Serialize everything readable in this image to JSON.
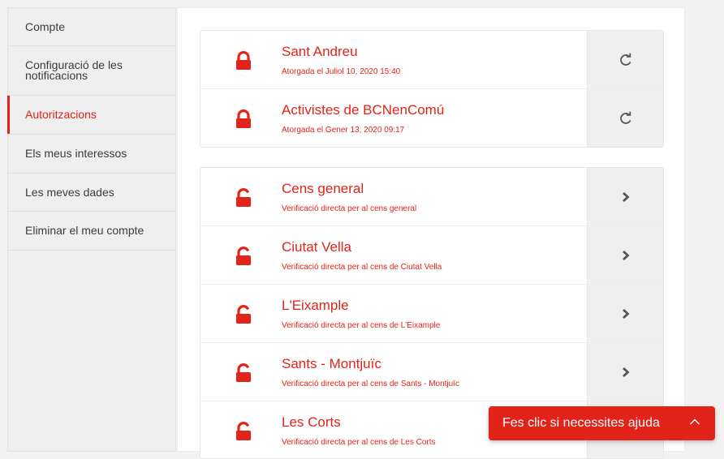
{
  "sidebar": {
    "items": [
      {
        "label": "Compte",
        "active": false
      },
      {
        "label": "Configuració de les notificacions",
        "active": false
      },
      {
        "label": "Autoritzacions",
        "active": true
      },
      {
        "label": "Els meus interessos",
        "active": false
      },
      {
        "label": "Les meves dades",
        "active": false
      },
      {
        "label": "Eliminar el meu compte",
        "active": false
      }
    ]
  },
  "granted": [
    {
      "title": "Sant Andreu",
      "subtitle": "Atorgada el Juliol 10, 2020 15:40",
      "icon": "lock-closed-icon",
      "action_icon": "refresh-icon"
    },
    {
      "title": "Activistes de BCNenComú",
      "subtitle": "Atorgada el Gener 13, 2020 09:17",
      "icon": "lock-closed-icon",
      "action_icon": "refresh-icon"
    }
  ],
  "available": [
    {
      "title": "Cens general",
      "subtitle": "Verificació directa per al cens general",
      "icon": "lock-open-icon",
      "action_icon": "chevron-right-icon"
    },
    {
      "title": "Ciutat Vella",
      "subtitle": "Verificació directa per al cens de Ciutat Vella",
      "icon": "lock-open-icon",
      "action_icon": "chevron-right-icon"
    },
    {
      "title": "L'Eixample",
      "subtitle": "Verificació directa per al cens de L'Eixample",
      "icon": "lock-open-icon",
      "action_icon": "chevron-right-icon"
    },
    {
      "title": "Sants - Montjuïc",
      "subtitle": "Verificació directa per al cens de Sants - Montjuïc",
      "icon": "lock-open-icon",
      "action_icon": "chevron-right-icon"
    },
    {
      "title": "Les Corts",
      "subtitle": "Verificació directa per al cens de Les Corts",
      "icon": "lock-open-icon",
      "action_icon": "chevron-right-icon"
    }
  ],
  "help": {
    "label": "Fes clic si necessites ajuda",
    "icon": "chevron-up-icon"
  },
  "colors": {
    "accent": "#e2231a",
    "sidebar_bg": "#efefef",
    "action_bg": "#efefef"
  }
}
